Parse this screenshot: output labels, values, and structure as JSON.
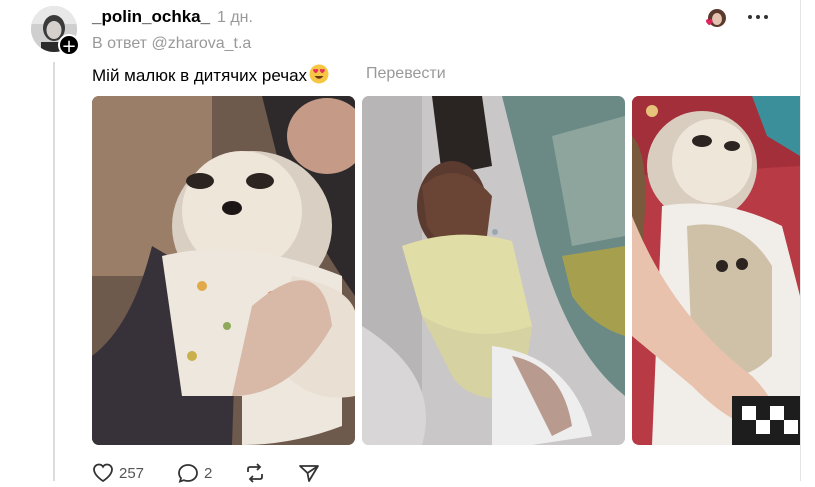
{
  "post": {
    "username": "_polin_ochka_",
    "time": "1 дн.",
    "reply_to": "В ответ @zharova_t.a",
    "text": "Мій малюк в дитячих речах",
    "text_emoji": "smiling-face-with-heart-eyes-icon",
    "translate_label": "Перевести",
    "likes": "257",
    "comments": "2"
  },
  "icons": {
    "like": "heart-icon",
    "comment": "comment-icon",
    "repost": "repost-icon",
    "share": "send-icon",
    "more": "more-horizontal-icon",
    "follow": "plus-icon"
  },
  "colors": {
    "secondary_text": "#999999",
    "like_heart": "#e0245e",
    "thread_line": "#dcdcdc"
  }
}
